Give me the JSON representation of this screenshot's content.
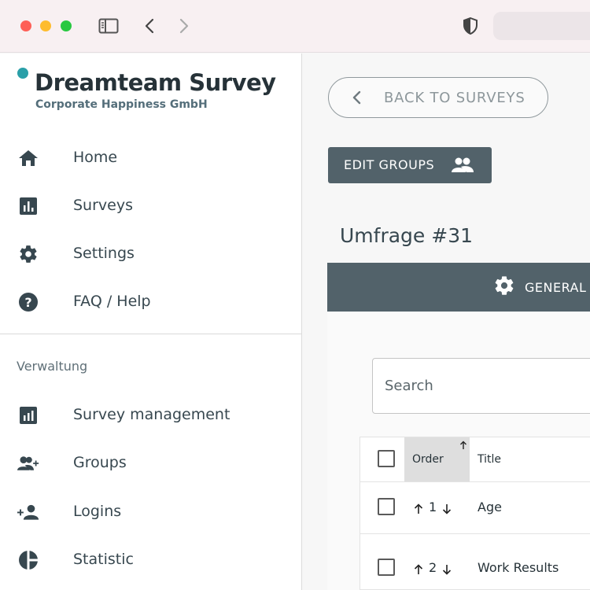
{
  "brand": {
    "title": "Dreamteam Survey",
    "subtitle": "Corporate Happiness GmbH",
    "accent": "#2a9fa8"
  },
  "nav": {
    "main": [
      {
        "label": "Home",
        "icon": "home-icon"
      },
      {
        "label": "Surveys",
        "icon": "bar-chart-icon"
      },
      {
        "label": "Settings",
        "icon": "gear-icon"
      },
      {
        "label": "FAQ / Help",
        "icon": "help-icon"
      }
    ],
    "section_label": "Verwaltung",
    "admin": [
      {
        "label": "Survey management",
        "icon": "chart-box-icon"
      },
      {
        "label": "Groups",
        "icon": "group-add-icon"
      },
      {
        "label": "Logins",
        "icon": "person-add-icon"
      },
      {
        "label": "Statistic",
        "icon": "pie-chart-icon"
      }
    ]
  },
  "main": {
    "back_label": "BACK TO SURVEYS",
    "edit_groups_label": "EDIT GROUPS",
    "page_title": "Umfrage #31",
    "tab_general_label": "GENERAL",
    "search_placeholder": "Search",
    "table": {
      "headers": {
        "order": "Order",
        "title": "Title"
      },
      "rows": [
        {
          "order": "1",
          "title": "Age"
        },
        {
          "order": "2",
          "title": "Work Results"
        }
      ]
    }
  },
  "colors": {
    "primary": "#52626a",
    "text": "#37474f"
  }
}
